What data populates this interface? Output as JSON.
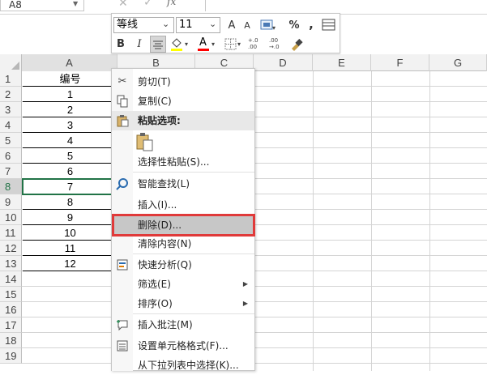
{
  "formula_bar": {
    "name_box": "A8",
    "cancel_glyph": "✕",
    "enter_glyph": "✓",
    "fx_label": "fx",
    "formula_value": ""
  },
  "columns": [
    "A",
    "B",
    "C",
    "D",
    "E",
    "F",
    "G"
  ],
  "rows": [
    "1",
    "2",
    "3",
    "4",
    "5",
    "6",
    "7",
    "8",
    "9",
    "10",
    "11",
    "12",
    "13",
    "14",
    "15",
    "16",
    "17",
    "18",
    "19"
  ],
  "column_a": [
    "编号",
    "1",
    "2",
    "3",
    "4",
    "5",
    "6",
    "7",
    "8",
    "9",
    "10",
    "11",
    "12"
  ],
  "selected_row": "8",
  "mini_toolbar": {
    "font_name": "等线",
    "font_size": "11",
    "grow_font": "A",
    "shrink_font": "A",
    "percent": "%",
    "comma": ",",
    "bold": "B",
    "italic": "I",
    "font_color_letter": "A",
    "increase_decimal": "+.0\n.00",
    "decrease_decimal": ".00\n→.0",
    "colors": {
      "fill": "#ffff00",
      "font": "#ff0000",
      "accent": "#217346"
    }
  },
  "context_menu": {
    "items": [
      {
        "label": "剪切(T)",
        "icon": "scissors-icon"
      },
      {
        "label": "复制(C)",
        "icon": "copy-icon"
      },
      {
        "label": "粘贴选项:",
        "icon": "clipboard-icon"
      },
      {
        "label": "选择性粘贴(S)...",
        "icon": ""
      },
      {
        "label": "智能查找(L)",
        "icon": "smart-lookup-icon"
      },
      {
        "label": "插入(I)...",
        "icon": ""
      },
      {
        "label": "删除(D)...",
        "icon": ""
      },
      {
        "label": "清除内容(N)",
        "icon": ""
      },
      {
        "label": "快速分析(Q)",
        "icon": "quick-analysis-icon"
      },
      {
        "label": "筛选(E)",
        "icon": ""
      },
      {
        "label": "排序(O)",
        "icon": ""
      },
      {
        "label": "插入批注(M)",
        "icon": "comment-icon"
      },
      {
        "label": "设置单元格格式(F)...",
        "icon": "format-cells-icon"
      },
      {
        "label": "从下拉列表中选择(K)...",
        "icon": ""
      }
    ],
    "highlight_color": "#e03a3a"
  }
}
